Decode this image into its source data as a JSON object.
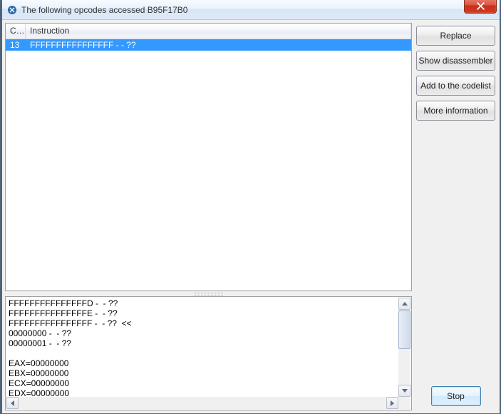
{
  "window": {
    "title": "The following opcodes accessed B95F17B0"
  },
  "list": {
    "columns": {
      "count": "C...",
      "instruction": "Instruction"
    },
    "rows": [
      {
        "count": "13",
        "instruction": "FFFFFFFFFFFFFFFF -  - ??"
      }
    ]
  },
  "memo": {
    "lines": [
      "FFFFFFFFFFFFFFFD -  - ??",
      "FFFFFFFFFFFFFFFE -  - ??",
      "FFFFFFFFFFFFFFFF -  - ??  <<",
      "00000000 -  - ??",
      "00000001 -  - ??",
      "",
      "EAX=00000000",
      "EBX=00000000",
      "ECX=00000000",
      "EDX=00000000"
    ]
  },
  "buttons": {
    "replace": "Replace",
    "show_disassembler": "Show disassembler",
    "add_to_codelist": "Add to the codelist",
    "more_information": "More information",
    "stop": "Stop"
  }
}
